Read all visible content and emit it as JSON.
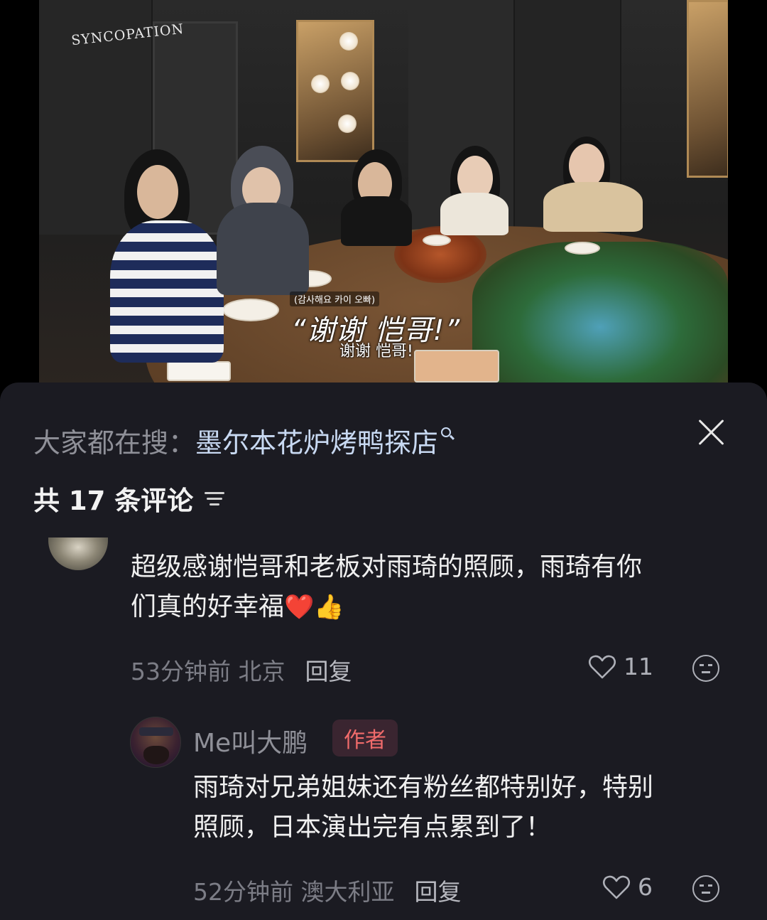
{
  "video": {
    "logo": "SYNCOPATION",
    "caption_korean": "(감사해요 카이 오빠)",
    "caption_main": "“谢谢 恺哥!”",
    "caption_sub": "谢谢 恺哥!"
  },
  "search": {
    "prefix": "大家都在搜：",
    "query": "墨尔本花炉烤鸭探店"
  },
  "comments_header": {
    "count_label": "共 17 条评论"
  },
  "comments": [
    {
      "text_line1": "超级感谢恺哥和老板对雨琦的照顾，雨琦有你",
      "text_line2": "们真的好幸福",
      "emoji1": "❤️",
      "emoji2": "👍",
      "time_location": "53分钟前 北京",
      "reply_label": "回复",
      "likes": "11"
    },
    {
      "author": "Me叫大鹏",
      "badge": "作者",
      "text_line1": "雨琦对兄弟姐妹还有粉丝都特别好，特别",
      "text_line2": "照顾，日本演出完有点累到了！",
      "time_location": "52分钟前 澳大利亚",
      "reply_label": "回复",
      "likes": "6"
    }
  ],
  "colors": {
    "sheet_bg": "#1b1b22",
    "search_link": "#c8d9f2",
    "author_badge": "#f16b6b"
  }
}
